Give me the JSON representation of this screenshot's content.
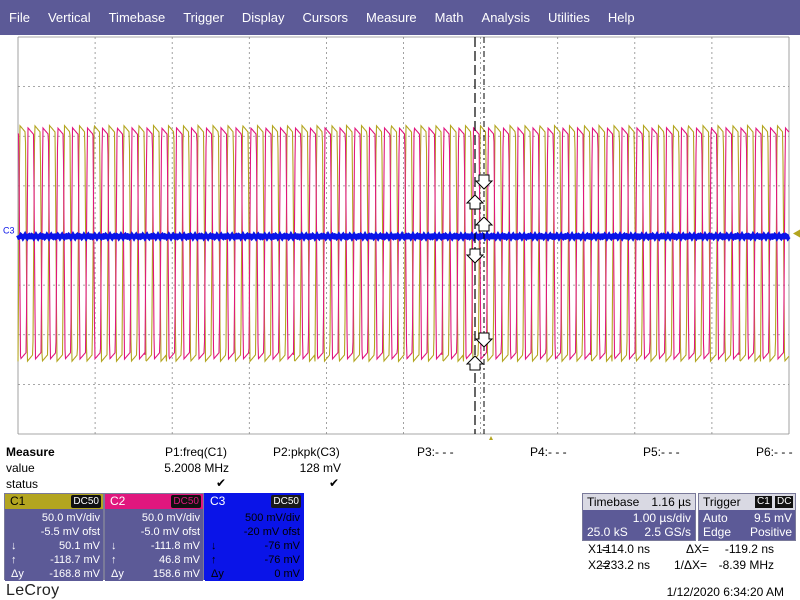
{
  "menu": [
    "File",
    "Vertical",
    "Timebase",
    "Trigger",
    "Display",
    "Cursors",
    "Measure",
    "Math",
    "Analysis",
    "Utilities",
    "Help"
  ],
  "colors": {
    "menu_bg": "#5c5a97",
    "c1": "#b3a520",
    "c2": "#e0177e",
    "c3": "#0a14e8",
    "grid": "#8a8a8a"
  },
  "scope": {
    "channel_marker": "C3"
  },
  "measure": {
    "title": "Measure",
    "row_value_label": "value",
    "row_status_label": "status",
    "params": [
      {
        "name": "P1:freq(C1)",
        "value": "5.2008 MHz",
        "status": "✔"
      },
      {
        "name": "P2:pkpk(C3)",
        "value": "128 mV",
        "status": "✔"
      },
      {
        "name": "P3:- - -",
        "value": "",
        "status": ""
      },
      {
        "name": "P4:- - -",
        "value": "",
        "status": ""
      },
      {
        "name": "P5:- - -",
        "value": "",
        "status": ""
      },
      {
        "name": "P6:- - -",
        "value": "",
        "status": ""
      }
    ]
  },
  "channels": [
    {
      "name": "C1",
      "coupling": "DC50",
      "vdiv": "50.0 mV/div",
      "offset": "-5.5 mV ofst",
      "down": "50.1 mV",
      "up": "-118.7 mV",
      "dy": "-168.8 mV"
    },
    {
      "name": "C2",
      "coupling": "DC50",
      "vdiv": "50.0 mV/div",
      "offset": "-5.0 mV ofst",
      "down": "-111.8 mV",
      "up": "46.8 mV",
      "dy": "158.6 mV"
    },
    {
      "name": "C3",
      "coupling": "DC50",
      "vdiv": "500 mV/div",
      "offset": "-20 mV ofst",
      "down": "-76 mV",
      "up": "-76 mV",
      "dy": "0 mV"
    }
  ],
  "row_symbols": {
    "down": "↓",
    "up": "↑",
    "dy": "Δy"
  },
  "timebase": {
    "title": "Timebase",
    "delay": "1.16 µs",
    "tdiv": "1.00 µs/div",
    "samples": "25.0 kS",
    "rate": "2.5 GS/s"
  },
  "trigger": {
    "title": "Trigger",
    "source": "C1",
    "coupling": "DC",
    "mode": "Auto",
    "level": "9.5 mV",
    "type": "Edge",
    "slope": "Positive"
  },
  "cursors": {
    "x1_label": "X1=",
    "x1": "-114.0 ns",
    "x2_label": "X2=",
    "x2": "-233.2 ns",
    "dx_label": "ΔX=",
    "dx": "-119.2 ns",
    "inv_dx_label": "1/ΔX=",
    "inv_dx": "-8.39 MHz"
  },
  "brand": "LeCroy",
  "timestamp": "1/12/2020 6:34:20 AM"
}
